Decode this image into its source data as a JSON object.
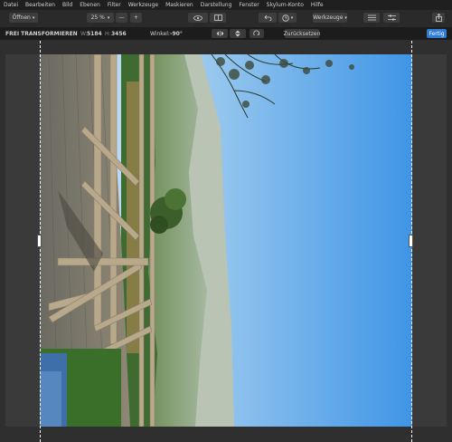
{
  "menu": [
    "Datei",
    "Bearbeiten",
    "Bild",
    "Ebenen",
    "Filter",
    "Werkzeuge",
    "Maskieren",
    "Darstellung",
    "Fenster",
    "Skylum-Konto",
    "Hilfe"
  ],
  "toolbar": {
    "open_label": "Öffnen",
    "zoom_value": "25 %",
    "minus_label": "—",
    "plus_label": "+",
    "tools_label": "Werkzeuge"
  },
  "options": {
    "mode_title": "FREI TRANSFORMIEREN",
    "width_label": "W:",
    "width_value": "5184",
    "height_label": "H:",
    "height_value": "3456",
    "angle_label": "Winkel:",
    "angle_value": "-90°",
    "reset_label": "Zurücksetzen",
    "done_label": "Fertig"
  },
  "colors": {
    "accent": "#2f7bd6"
  }
}
